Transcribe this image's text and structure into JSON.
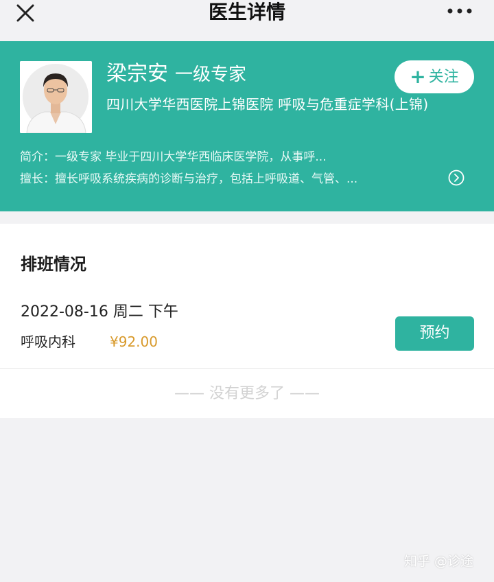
{
  "nav": {
    "title": "医生详情",
    "close_icon": "close-icon",
    "more_icon": "more-icon"
  },
  "doctor": {
    "name": "梁宗安",
    "rank": "一级专家",
    "hospital_dept": "四川大学华西医院上锦医院 呼吸与危重症学科(上锦)",
    "intro": "简介：一级专家 毕业于四川大学华西临床医学院，从事呼...",
    "skill": "擅长：擅长呼吸系统疾病的诊断与治疗，包括上呼吸道、气管、...",
    "follow_label": "关注",
    "follow_icon": "plus-icon",
    "detail_icon": "chevron-right-circle-icon"
  },
  "schedule": {
    "title": "排班情况",
    "slots": [
      {
        "date": "2022-08-16 周二 下午",
        "dept": "呼吸内科",
        "price": "¥92.00",
        "book_label": "预约"
      }
    ],
    "no_more": "—— 没有更多了 ——"
  },
  "watermark": "知乎 @诊途",
  "colors": {
    "accent": "#2fb3a0",
    "price": "#d89a2c",
    "background": "#f2f2f4"
  }
}
